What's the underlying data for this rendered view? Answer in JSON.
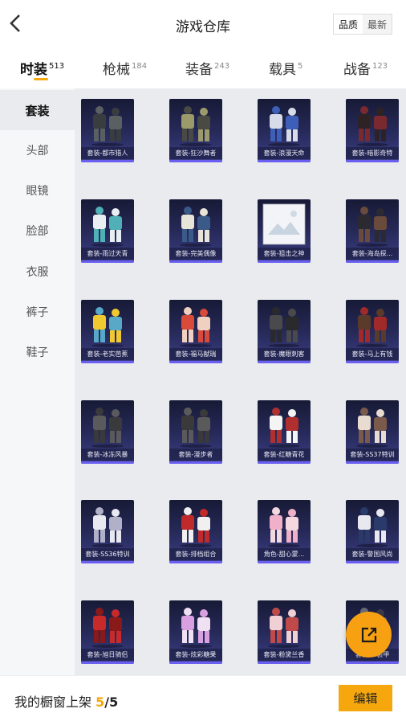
{
  "header": {
    "title": "游戏仓库",
    "sort_options": [
      "品质",
      "最新"
    ]
  },
  "tabs": [
    {
      "label": "时装",
      "count": "513",
      "active": true
    },
    {
      "label": "枪械",
      "count": "184"
    },
    {
      "label": "装备",
      "count": "243"
    },
    {
      "label": "载具",
      "count": "5"
    },
    {
      "label": "战备",
      "count": "123"
    }
  ],
  "sidebar": {
    "items": [
      "套装",
      "头部",
      "眼镜",
      "脸部",
      "衣服",
      "裤子",
      "鞋子"
    ]
  },
  "items": [
    {
      "label": "套装-都市猎人",
      "icon": "dark-armor-suit-icon"
    },
    {
      "label": "套装-狂沙舞者",
      "icon": "desert-suit-icon"
    },
    {
      "label": "套装-浪漫天命",
      "icon": "blue-white-suit-icon"
    },
    {
      "label": "套装-暗影奇特",
      "icon": "dark-red-suit-icon"
    },
    {
      "label": "套装-雨过天青",
      "icon": "white-suit-pair-icon"
    },
    {
      "label": "套装-完美偶像",
      "icon": "idol-suit-icon"
    },
    {
      "label": "套装-狙击之神",
      "icon": "image-placeholder-icon"
    },
    {
      "label": "套装-海岛探...",
      "icon": "explorer-suit-icon"
    },
    {
      "label": "套装-老实芭蕉",
      "icon": "banana-suit-icon"
    },
    {
      "label": "套装-福马献瑞",
      "icon": "red-costume-pair-icon"
    },
    {
      "label": "套装-魔眼刺客",
      "icon": "assassin-suit-icon"
    },
    {
      "label": "套装-马上有钱",
      "icon": "horse-head-suit-icon"
    },
    {
      "label": "套装-冰冻风暴",
      "icon": "frost-armor-suit-icon"
    },
    {
      "label": "套装-漫步者",
      "icon": "walker-suit-icon"
    },
    {
      "label": "套装-红糖青花",
      "icon": "white-dress-pair-icon"
    },
    {
      "label": "套装-SS37特训",
      "icon": "training-suit-pair-icon"
    },
    {
      "label": "套装-SS36特训",
      "icon": "small-training-suit-icon"
    },
    {
      "label": "套装-排档组合",
      "icon": "red-jacket-suit-icon"
    },
    {
      "label": "角色-甜心蒙...",
      "icon": "pink-character-icon"
    },
    {
      "label": "套装-警国风尚",
      "icon": "white-uniform-pair-icon"
    },
    {
      "label": "套装-旭日骑侣",
      "icon": "red-jacket-icon"
    },
    {
      "label": "套装-炫彩糖果",
      "icon": "candy-suit-pair-icon"
    },
    {
      "label": "套装-粉黛兰香",
      "icon": "pink-dress-pair-icon"
    },
    {
      "label": "套装-...装甲",
      "icon": "armor-suit-icon"
    }
  ],
  "footer": {
    "label": "我的橱窗上架",
    "current": "5",
    "total": "/5",
    "edit_label": "编辑"
  },
  "colors": {
    "accent": "#f5a70d",
    "card_top": "#171a35",
    "card_bottom": "#3c3f86"
  }
}
